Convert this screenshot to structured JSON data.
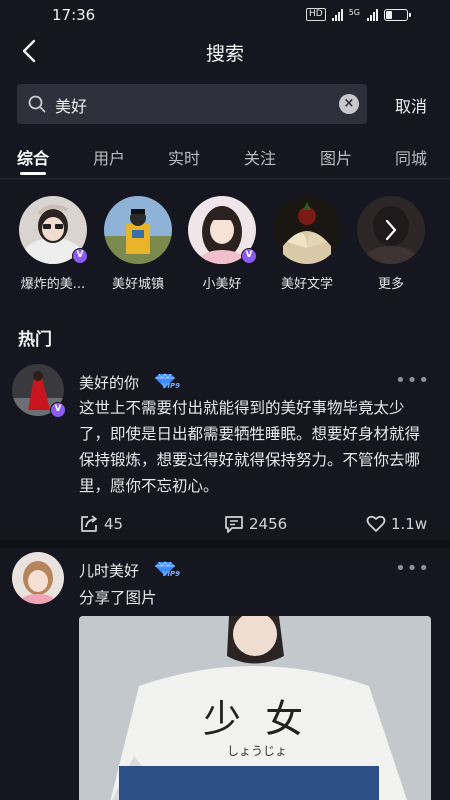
{
  "status_bar": {
    "time": "17:36",
    "net_badge": "HD",
    "signal_1_label": "",
    "signal_2_label": "5G",
    "battery_level": 0.3
  },
  "nav": {
    "title": "搜索",
    "back_icon": "chevron-left-icon"
  },
  "search": {
    "value": "美好",
    "cancel_label": "取消",
    "icon": "search-icon",
    "clear_icon": "clear-icon"
  },
  "tabs": [
    "综合",
    "用户",
    "实时",
    "关注",
    "图片",
    "同城"
  ],
  "active_tab": 0,
  "accounts": [
    {
      "name": "爆炸的美...",
      "verified": true
    },
    {
      "name": "美好城镇",
      "verified": false
    },
    {
      "name": "小美好",
      "verified": true
    },
    {
      "name": "美好文学",
      "verified": false
    },
    {
      "name": "更多",
      "verified": false
    }
  ],
  "section_title": "热门",
  "posts": [
    {
      "author": "美好的你",
      "vip_label": "VIP9",
      "text": "这世上不需要付出就能得到的美好事物毕竟太少了，即使是日出都需要牺牲睡眠。想要好身材就得保持锻炼，想要过得好就得保持努力。不管你去哪里，愿你不忘初心。",
      "shares": "45",
      "comments": "2456",
      "likes": "1.1w"
    },
    {
      "author": "儿时美好",
      "vip_label": "VIP9",
      "text": "分享了图片",
      "image_text": "少 女",
      "image_subtext": "しょうじょ"
    }
  ],
  "colors": {
    "background": "#15161f",
    "search_bg": "#2d2f3a",
    "verified": "#8c5cf2",
    "vip": "#3d8dff"
  }
}
